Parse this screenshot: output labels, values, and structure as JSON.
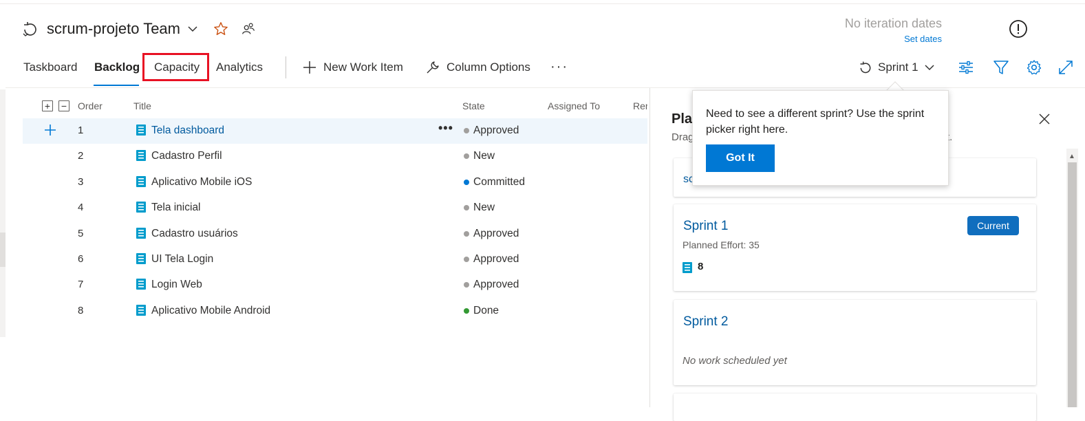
{
  "header": {
    "team_name": "scrum-projeto Team",
    "iteration_status": "No iteration dates",
    "set_dates": "Set dates"
  },
  "tabs": [
    {
      "label": "Taskboard"
    },
    {
      "label": "Backlog",
      "active": true
    },
    {
      "label": "Capacity",
      "highlighted": true
    },
    {
      "label": "Analytics"
    }
  ],
  "toolbar": {
    "new_work_item": "New Work Item",
    "column_options": "Column Options",
    "more": "···",
    "sprint_picker": "Sprint 1"
  },
  "backlog": {
    "columns": [
      "Order",
      "Title",
      "State",
      "Assigned To",
      "Rer"
    ],
    "rows": [
      {
        "order": "1",
        "title": "Tela dashboard",
        "state": "Approved",
        "state_color": "#a19f9d"
      },
      {
        "order": "2",
        "title": "Cadastro Perfil",
        "state": "New",
        "state_color": "#a19f9d"
      },
      {
        "order": "3",
        "title": "Aplicativo Mobile iOS",
        "state": "Committed",
        "state_color": "#0078d4"
      },
      {
        "order": "4",
        "title": "Tela inicial",
        "state": "New",
        "state_color": "#a19f9d"
      },
      {
        "order": "5",
        "title": "Cadastro usuários",
        "state": "Approved",
        "state_color": "#a19f9d"
      },
      {
        "order": "6",
        "title": "UI Tela Login",
        "state": "Approved",
        "state_color": "#a19f9d"
      },
      {
        "order": "7",
        "title": "Login Web",
        "state": "Approved",
        "state_color": "#a19f9d"
      },
      {
        "order": "8",
        "title": "Aplicativo Mobile Android",
        "state": "Done",
        "state_color": "#339933"
      }
    ],
    "row_more": "•••"
  },
  "planning": {
    "title": "Pla",
    "subtitle": "Drag",
    "subtitle_end": "t.",
    "partial_card_text": "sc",
    "cards": [
      {
        "name": "Sprint 1",
        "effort": "Planned Effort: 35",
        "count": "8",
        "badge": "Current"
      },
      {
        "name": "Sprint 2",
        "empty_text": "No work scheduled yet"
      }
    ]
  },
  "callout": {
    "text": "Need to see a different sprint? Use the sprint picker right here.",
    "button": "Got It"
  },
  "colors": {
    "accent": "#0078d4",
    "highlight_box": "#e81123",
    "star": "#ca5010",
    "work_item_icon": "#009ccc"
  },
  "icons": [
    "sprint-cycle-icon",
    "chevron-down-icon",
    "star-icon",
    "team-members-icon",
    "alert-icon",
    "plus-icon",
    "wrench-icon",
    "view-options-icon",
    "filter-icon",
    "gear-icon",
    "expand-icon",
    "work-item-icon",
    "close-icon"
  ]
}
